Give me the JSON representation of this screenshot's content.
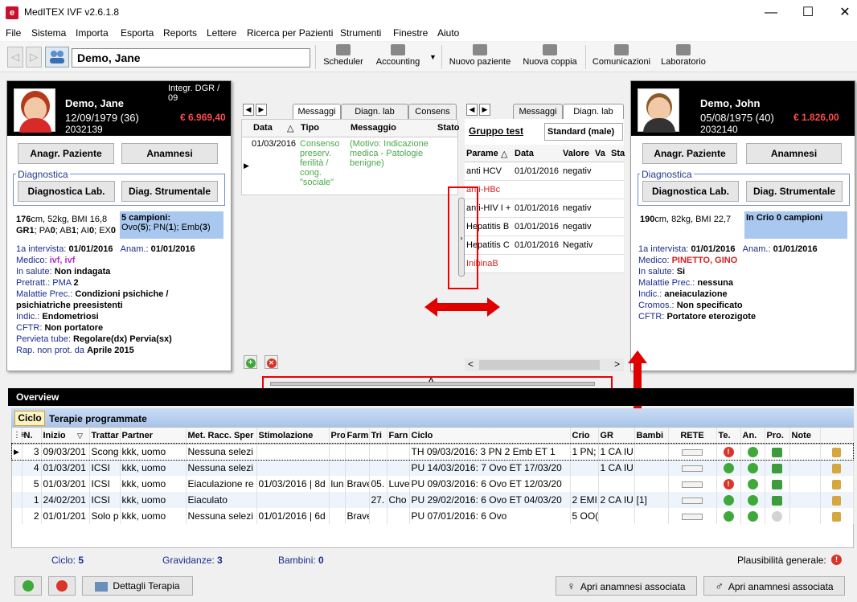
{
  "window": {
    "title": "MedITEX IVF v2.6.1.8",
    "icon_letter": "e",
    "minimize": "—",
    "maximize": "☐",
    "close": "✕"
  },
  "menu": [
    "File",
    "Sistema",
    "Importa",
    "Esporta",
    "Reports",
    "Lettere",
    "Ricerca per Pazienti",
    "Strumenti",
    "Finestre",
    "Aiuto"
  ],
  "toolbar": {
    "patient_name": "Demo, Jane",
    "nav_back": "◁",
    "nav_forward": "▷",
    "buttons": [
      "Scheduler",
      "Accounting",
      "Nuovo paziente",
      "Nuova coppia",
      "Comunicazioni",
      "Laboratorio"
    ],
    "dropdown_arrow": "▼"
  },
  "female": {
    "integr": "Integr. DGR / 09",
    "name": "Demo, Jane",
    "dob": "12/09/1979  (36)",
    "id": "2032139",
    "amount": "€ 6.969,40",
    "btn_anagr": "Anagr. Paziente",
    "btn_anamnesi": "Anamnesi",
    "diag_label": "Diagnostica",
    "btn_diag_lab": "Diagnostica Lab.",
    "btn_diag_str": "Diag. Strumentale",
    "measures_height": "176",
    "measures_rest": "cm, 52kg, BMI 16,8",
    "gr_line": {
      "gr_l": "GR",
      "gr_v": "1",
      "pa_l": "; PA",
      "pa_v": "0",
      "ab_l": "; AB",
      "ab_v": "1",
      "ai_l": "; AI",
      "ai_v": "0",
      "ex_l": "; EX",
      "ex_v": "0"
    },
    "campioni_title": "5 campioni:",
    "campioni_detail": {
      "ovo_l": "Ovo(",
      "ovo_v": "5",
      "pn_l": "); PN(",
      "pn_v": "1",
      "emb_l": "); Emb(",
      "emb_v": "3",
      "end": ")"
    },
    "interview_label": "1a intervista:",
    "interview_date": "01/01/2016",
    "anam_label": "Anam.:",
    "anam_date": "01/01/2016",
    "medico_label": "Medico:",
    "medico_value": "ivf, ivf",
    "salute_label": "In salute:",
    "salute_value": "Non indagata",
    "pretratt_label": "Pretratt.:",
    "pretratt_pma": "PMA",
    "pretratt_value": "2",
    "malattie_label": "Malattie Prec.:",
    "malattie_value_1": "Condizioni psichiche /",
    "malattie_value_2": "psichiatriche preesistenti",
    "indic_label": "Indic.:",
    "indic_value": "Endometriosi",
    "cftr_label": "CFTR:",
    "cftr_value": "Non portatore",
    "pervieta_label": "Pervieta tube:",
    "pervieta_value": "Regolare(dx) Pervia(sx)",
    "rap_label": "Rap. non prot. da",
    "rap_value": "Aprile 2015"
  },
  "male": {
    "name": "Demo, John",
    "dob": "05/08/1975  (40)",
    "id": "2032140",
    "amount": "€ 1.826,00",
    "btn_anagr": "Anagr. Paziente",
    "btn_anamnesi": "Anamnesi",
    "diag_label": "Diagnostica",
    "btn_diag_lab": "Diagnostica Lab.",
    "btn_diag_str": "Diag. Strumentale",
    "measures_height": "190",
    "measures_rest": "cm, 82kg, BMI 22,7",
    "crio": "In Crio 0 campioni",
    "interview_label": "1a intervista:",
    "interview_date": "01/01/2016",
    "anam_label": "Anam.:",
    "anam_date": "01/01/2016",
    "medico_label": "Medico:",
    "medico_value": "PINETTO, GINO",
    "salute_label": "In salute:",
    "salute_value": "Si",
    "malattie_label": "Malattie Prec.:",
    "malattie_value": "nessuna",
    "indic_label": "Indic.:",
    "indic_value": "aneiaculazione",
    "cromos_label": "Cromos.:",
    "cromos_value": "Non specificato",
    "cftr_label": "CFTR:",
    "cftr_value": "Portatore eterozigote"
  },
  "messages": {
    "tabs": [
      "Messaggi",
      "Diagn. lab",
      "Consens"
    ],
    "nav_left": "◀",
    "nav_right": "▶",
    "headers": [
      "Data",
      "Tipo",
      "Messaggio",
      "Stato"
    ],
    "sort_indicator": "△",
    "row_pointer": "▶",
    "row": {
      "date": "01/03/2016",
      "tipo": "Consenso preserv. ferilità / cong. \"sociale\"",
      "messaggio": "(Motivo: Indicazione medica - Patologie benigne)"
    },
    "add": "+",
    "remove": "✕"
  },
  "lab": {
    "tabs": [
      "Messaggi",
      "Diagn. lab"
    ],
    "nav_left": "◀",
    "nav_right": "▶",
    "gruppo_label": "Gruppo test",
    "gruppo_value": "Standard (male)",
    "headers": [
      "Parame",
      "Data",
      "Valore",
      "Va",
      "Sta"
    ],
    "sort_indicator": "△",
    "splitter_arrow": "›",
    "rows": [
      {
        "param": "anti HCV",
        "data": "01/01/2016",
        "valore": "negativ",
        "red": false
      },
      {
        "param": "anti-HBc",
        "data": "",
        "valore": "",
        "red": true
      },
      {
        "param": "anti-HIV I +",
        "data": "01/01/2016",
        "valore": "negativ",
        "red": false
      },
      {
        "param": "Hepatitis B",
        "data": "01/01/2016",
        "valore": "negativ",
        "red": false
      },
      {
        "param": "Hepatitis C",
        "data": "01/01/2016",
        "valore": "Negativ",
        "red": false
      },
      {
        "param": "InibinaB",
        "data": "",
        "valore": "",
        "red": true
      }
    ],
    "scroll_left": "<",
    "scroll_right": ">"
  },
  "splitter": {
    "caret": "^"
  },
  "overview": {
    "title": "Overview",
    "tabs": [
      "Ciclo",
      "Terapie programmate"
    ],
    "headers": [
      "N.",
      "Inizio",
      "Trattar",
      "Partner",
      "Met. Racc. Sper",
      "Stimolazione",
      "Pro",
      "Farm",
      "Tri",
      "Farn",
      "Ciclo",
      "Crio",
      "GR",
      "Bambi",
      "RETE",
      "Te.",
      "An.",
      "Pro.",
      "Note"
    ],
    "grid_icon": "⋮≡",
    "sort_indicator": "▽",
    "row_pointer": "▶",
    "warn_glyph": "!",
    "rows": [
      {
        "n": "3",
        "inizio": "09/03/201",
        "tratt": "Scong",
        "partner": "kkk, uomo",
        "met": "Nessuna selezi",
        "stim": "",
        "pro": "",
        "farm": "",
        "tri": "",
        "farn": "",
        "ciclo": "TH 09/03/2016: 3 PN 2 Emb       ET 1",
        "crio": "1 PN;",
        "gr": "1 CA IU",
        "bambi": "",
        "te": "warn",
        "an": "ok",
        "pr": "thumb",
        "selected": true
      },
      {
        "n": "4",
        "inizio": "01/03/201",
        "tratt": "ICSI",
        "partner": "kkk, uomo",
        "met": "Nessuna selezi",
        "stim": "",
        "pro": "",
        "farm": "",
        "tri": "",
        "farn": "",
        "ciclo": "PU 14/03/2016: 7 Ovo      ET 17/03/20",
        "crio": "",
        "gr": "1 CA IU",
        "bambi": "",
        "te": "ok",
        "an": "ok",
        "pr": "thumb",
        "selected": false
      },
      {
        "n": "5",
        "inizio": "01/03/201",
        "tratt": "ICSI",
        "partner": "kkk, uomo",
        "met": "Eiaculazione re",
        "stim": "01/03/2016 | 8d",
        "pro": "lun",
        "farm": "Brave",
        "tri": "05.",
        "farn": "Luve",
        "ciclo": "PU 09/03/2016: 6 Ovo      ET 12/03/20",
        "crio": "",
        "gr": "",
        "bambi": "",
        "te": "warn",
        "an": "ok",
        "pr": "thumb",
        "selected": false
      },
      {
        "n": "1",
        "inizio": "24/02/201",
        "tratt": "ICSI",
        "partner": "kkk, uomo",
        "met": "Eiaculato",
        "stim": "",
        "pro": "",
        "farm": "",
        "tri": "27.",
        "farn": "Cho",
        "ciclo": "PU 29/02/2016: 6 Ovo      ET 04/03/20",
        "crio": "2 EMI",
        "gr": "2 CA IU",
        "bambi": "[1]",
        "te": "ok",
        "an": "ok",
        "pr": "thumb",
        "selected": false
      },
      {
        "n": "2",
        "inizio": "01/01/201",
        "tratt": "Solo p",
        "partner": "kkk, uomo",
        "met": "Nessuna selezi",
        "stim": "01/01/2016 | 6d",
        "pro": "",
        "farm": "Brave",
        "tri": "",
        "farn": "",
        "ciclo": "PU 07/01/2016: 6 Ovo",
        "crio": "5 OO(",
        "gr": "",
        "bambi": "",
        "te": "ok",
        "an": "ok",
        "pr": "gray",
        "selected": false
      }
    ],
    "stats": {
      "ciclo_label": "Ciclo:",
      "ciclo": "5",
      "grav_label": "Gravidanze:",
      "grav": "3",
      "bamb_label": "Bambini:",
      "bamb": "0",
      "plaus_label": "Plausibilità generale:"
    }
  },
  "bottom": {
    "dettagli": "Dettagli Terapia",
    "apri_f": "Apri anamnesi associata",
    "apri_m": "Apri anamnesi associata",
    "female_symbol": "♀",
    "male_symbol": "♂"
  },
  "colors": {
    "money": "#ff4a4a",
    "campioni_bg": "#a9c8f0",
    "red_highlight": "#e00000",
    "ok": "#3fa83a",
    "warn": "#d9362b"
  }
}
